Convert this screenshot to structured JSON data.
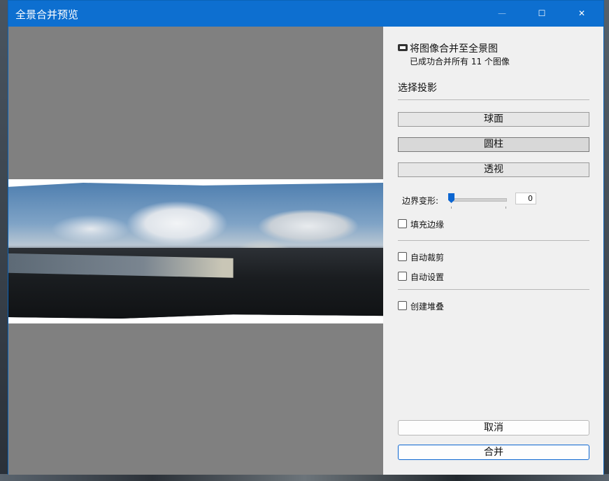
{
  "window": {
    "title": "全景合并预览",
    "minimize": "—",
    "maximize": "☐",
    "close": "✕"
  },
  "panel": {
    "header_title": "将图像合并至全景图",
    "header_subtitle": "已成功合并所有 11 个图像",
    "projection_label": "选择投影",
    "projections": [
      "球面",
      "圆柱",
      "透视"
    ],
    "selected_projection": "圆柱",
    "boundary_warp_label": "边界变形:",
    "boundary_warp_value": "0",
    "fill_edges_label": "填充边缘",
    "auto_crop_label": "自动裁剪",
    "auto_settings_label": "自动设置",
    "create_stack_label": "创建堆叠",
    "cancel_label": "取消",
    "merge_label": "合并"
  },
  "checkboxes": {
    "fill_edges": false,
    "auto_crop": false,
    "auto_settings": false,
    "create_stack": false
  }
}
